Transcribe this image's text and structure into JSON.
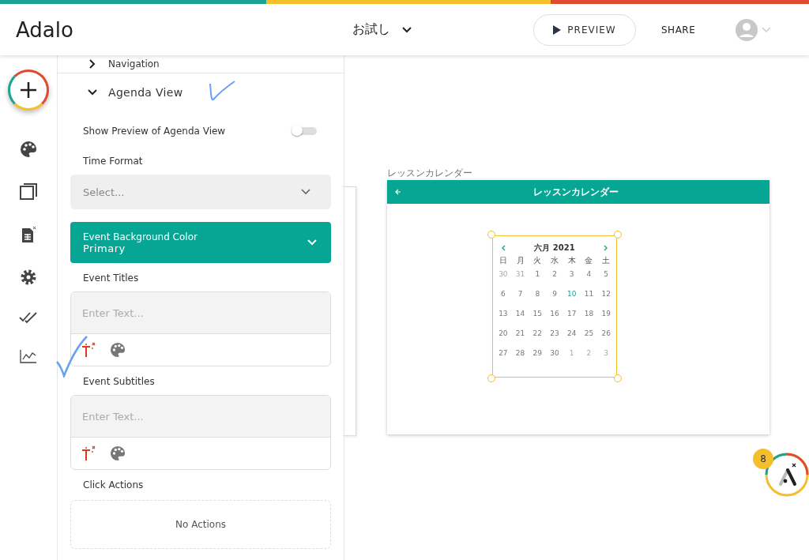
{
  "header": {
    "logo": "Adalo",
    "app_name": "お試し",
    "preview": "PREVIEW",
    "share": "SHARE"
  },
  "panel": {
    "sections": [
      {
        "title": "Navigation",
        "expanded": false
      },
      {
        "title": "Agenda View",
        "expanded": true
      }
    ],
    "preview_toggle": {
      "label": "Show Preview of Agenda View",
      "on": false
    },
    "time_format": {
      "label": "Time Format",
      "placeholder": "Select..."
    },
    "event_background": {
      "label": "Event Background Color",
      "value": "Primary"
    },
    "event_titles": {
      "label": "Event Titles",
      "placeholder": "Enter Text..."
    },
    "event_subtitles": {
      "label": "Event Subtitles",
      "placeholder": "Enter Text..."
    },
    "click_actions": {
      "label": "Click Actions",
      "empty": "No Actions"
    }
  },
  "canvas": {
    "screen_label": "レッスンカレンダー",
    "screen_title": "レッスンカレンダー",
    "calendar": {
      "month": "六月 2021",
      "weekdays": [
        "日",
        "月",
        "火",
        "水",
        "木",
        "金",
        "土"
      ],
      "days": [
        {
          "d": "30",
          "kind": "other"
        },
        {
          "d": "31",
          "kind": "other"
        },
        {
          "d": "1",
          "kind": "current"
        },
        {
          "d": "2",
          "kind": "current"
        },
        {
          "d": "3",
          "kind": "current"
        },
        {
          "d": "4",
          "kind": "current"
        },
        {
          "d": "5",
          "kind": "current"
        },
        {
          "d": "6",
          "kind": "current"
        },
        {
          "d": "7",
          "kind": "current"
        },
        {
          "d": "8",
          "kind": "current"
        },
        {
          "d": "9",
          "kind": "current"
        },
        {
          "d": "10",
          "kind": "today"
        },
        {
          "d": "11",
          "kind": "current"
        },
        {
          "d": "12",
          "kind": "current"
        },
        {
          "d": "13",
          "kind": "current"
        },
        {
          "d": "14",
          "kind": "current"
        },
        {
          "d": "15",
          "kind": "current"
        },
        {
          "d": "16",
          "kind": "current"
        },
        {
          "d": "17",
          "kind": "current"
        },
        {
          "d": "18",
          "kind": "current"
        },
        {
          "d": "19",
          "kind": "current"
        },
        {
          "d": "20",
          "kind": "current"
        },
        {
          "d": "21",
          "kind": "current"
        },
        {
          "d": "22",
          "kind": "current"
        },
        {
          "d": "23",
          "kind": "current"
        },
        {
          "d": "24",
          "kind": "current"
        },
        {
          "d": "25",
          "kind": "current"
        },
        {
          "d": "26",
          "kind": "current"
        },
        {
          "d": "27",
          "kind": "current"
        },
        {
          "d": "28",
          "kind": "current"
        },
        {
          "d": "29",
          "kind": "current"
        },
        {
          "d": "30",
          "kind": "current"
        },
        {
          "d": "1",
          "kind": "other"
        },
        {
          "d": "2",
          "kind": "other"
        },
        {
          "d": "3",
          "kind": "other"
        }
      ]
    }
  },
  "help": {
    "badge": "8"
  }
}
